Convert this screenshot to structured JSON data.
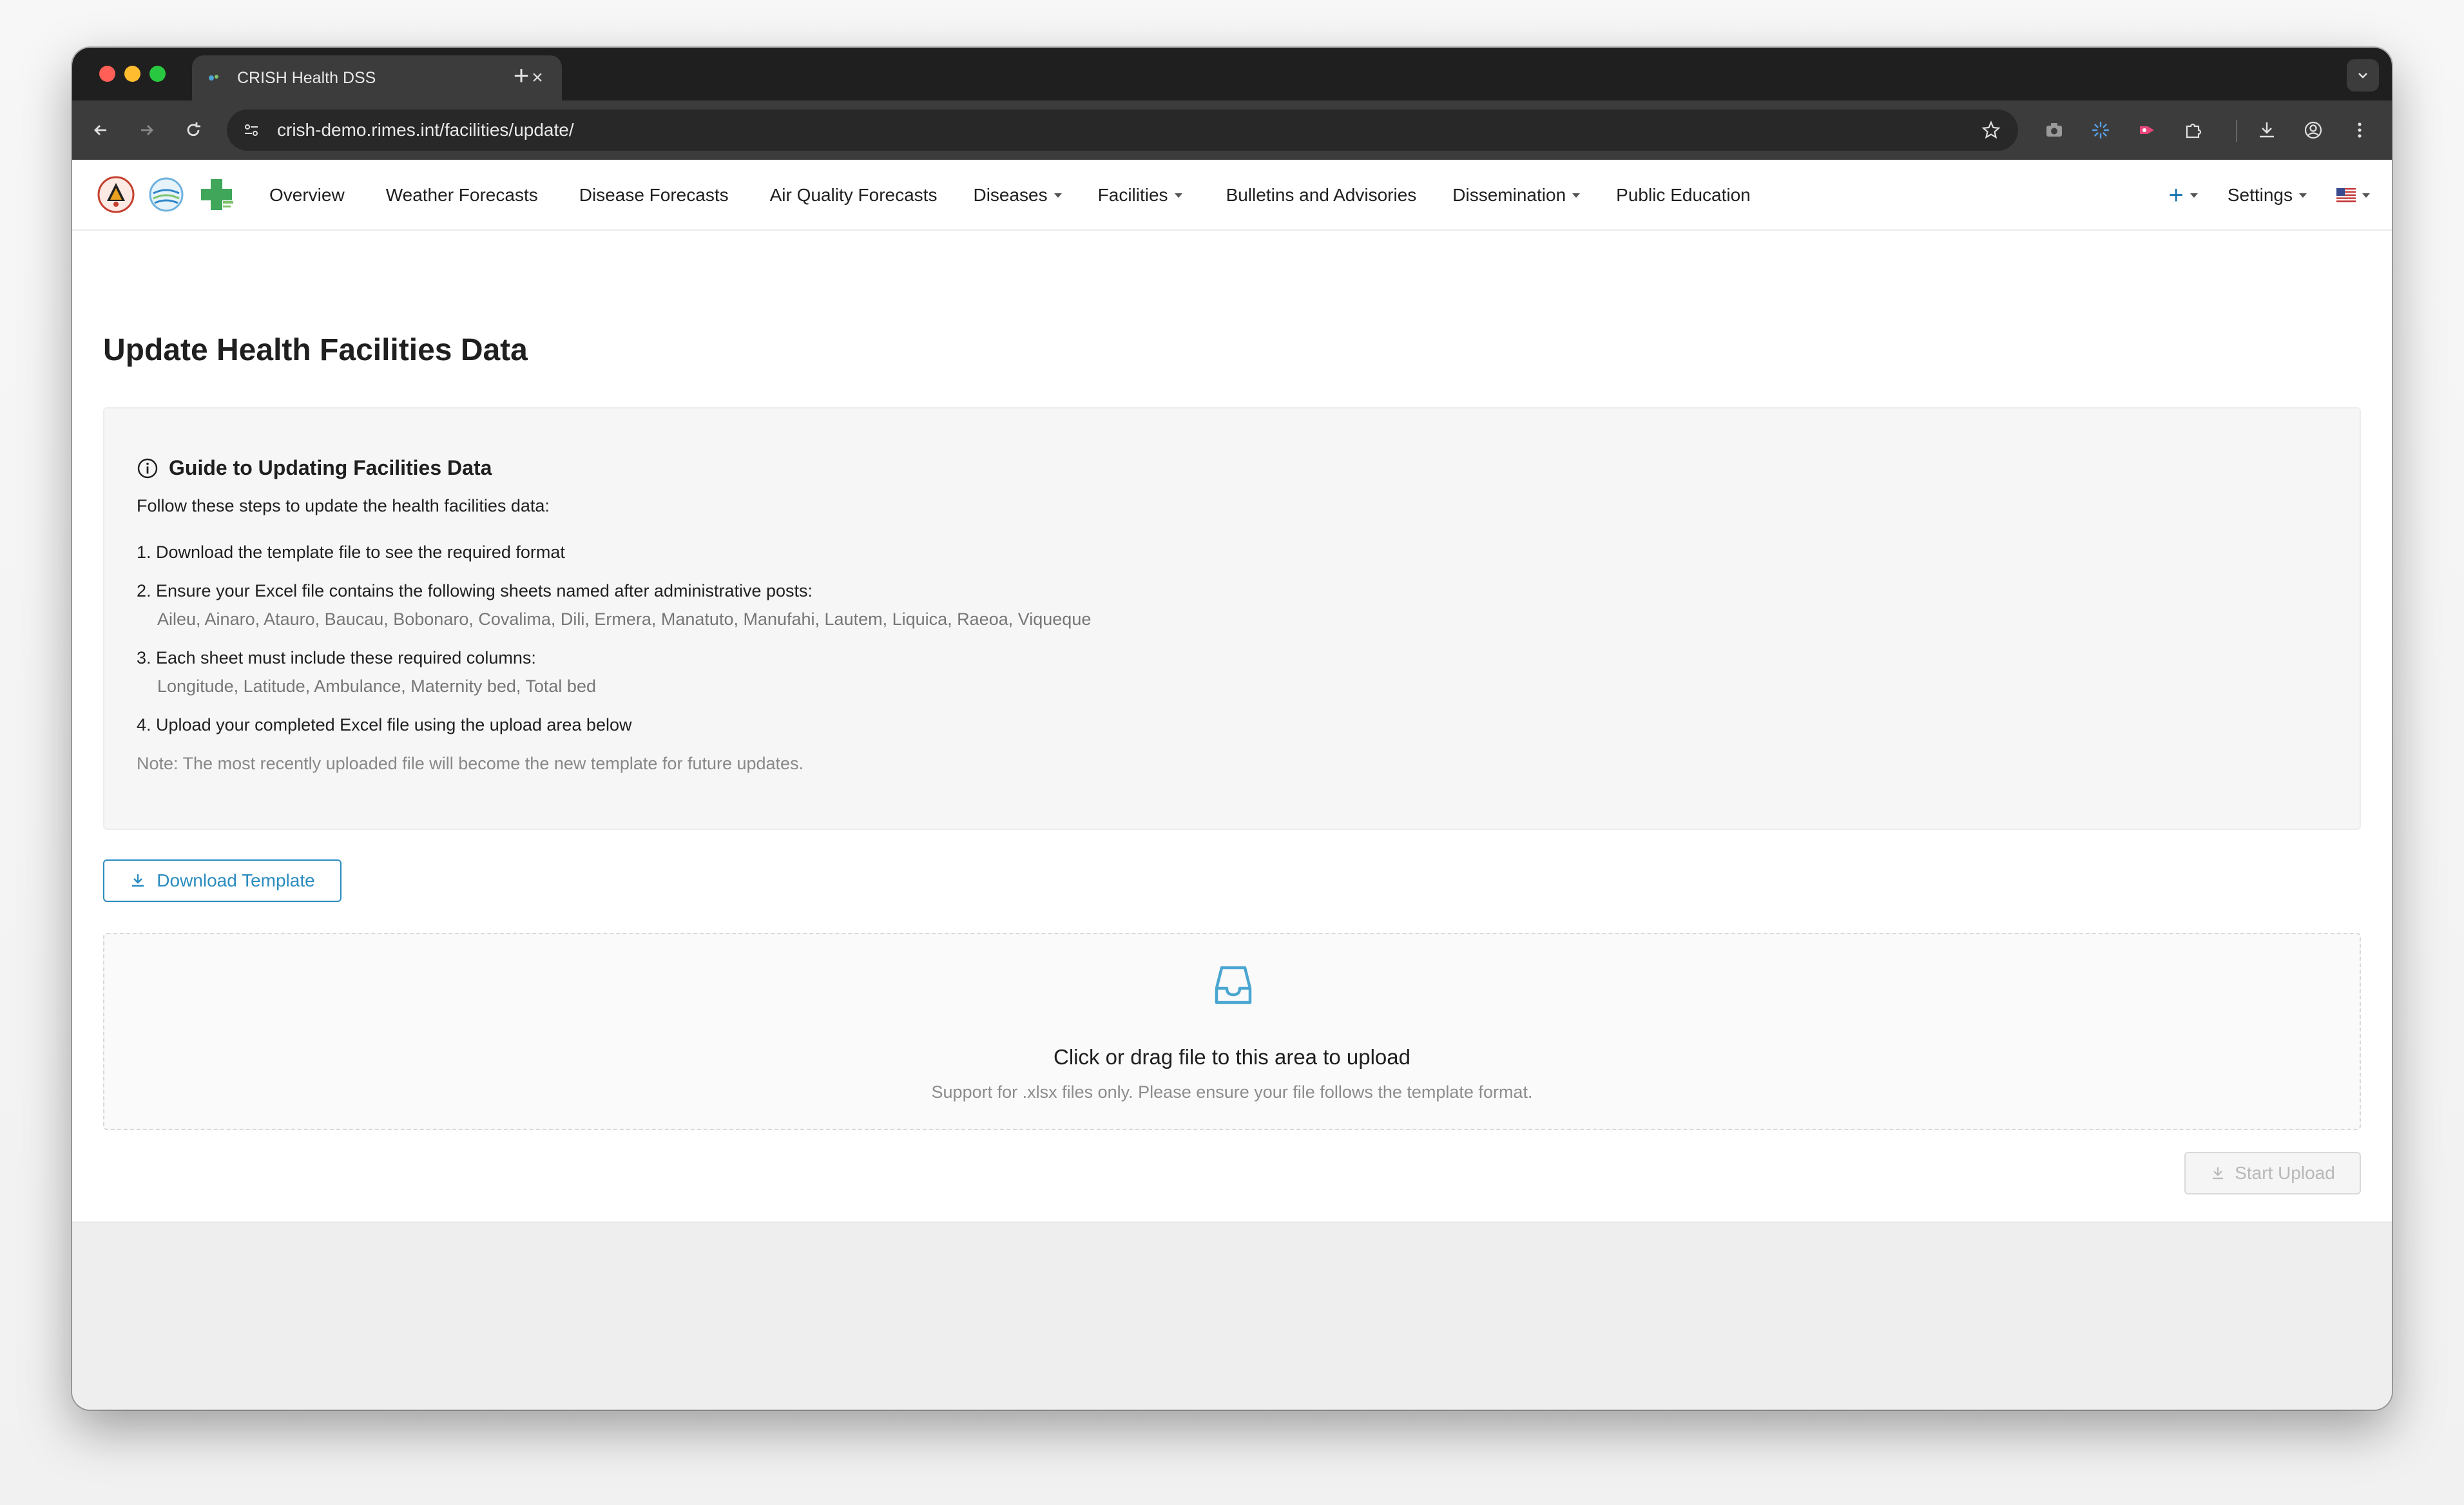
{
  "browser": {
    "tab_title": "CRISH Health DSS",
    "tab_close": "×",
    "new_tab": "+",
    "url": "crish-demo.rimes.int/facilities/update/"
  },
  "navbar": {
    "items": [
      {
        "label": "Overview",
        "dropdown": false
      },
      {
        "label": "Weather Forecasts",
        "dropdown": false
      },
      {
        "label": "Disease Forecasts",
        "dropdown": false
      },
      {
        "label": "Air Quality Forecasts",
        "dropdown": false
      },
      {
        "label": "Diseases",
        "dropdown": true
      },
      {
        "label": "Facilities",
        "dropdown": true
      },
      {
        "label": "Bulletins and Advisories",
        "dropdown": false
      },
      {
        "label": "Dissemination",
        "dropdown": true
      },
      {
        "label": "Public Education",
        "dropdown": false
      }
    ],
    "plus": "+",
    "settings": "Settings"
  },
  "page": {
    "title": "Update Health Facilities Data",
    "guide": {
      "heading": "Guide to Updating Facilities Data",
      "intro": "Follow these steps to update the health facilities data:",
      "step1": "1. Download the template file to see the required format",
      "step2": "2. Ensure your Excel file contains the following sheets named after administrative posts:",
      "step2_detail": "Aileu, Ainaro, Atauro, Baucau, Bobonaro, Covalima, Dili, Ermera, Manatuto, Manufahi, Lautem, Liquica, Raeoa, Viqueque",
      "step3": "3. Each sheet must include these required columns:",
      "step3_detail": "Longitude, Latitude, Ambulance, Maternity bed, Total bed",
      "step4": "4. Upload your completed Excel file using the upload area below",
      "note": "Note: The most recently uploaded file will become the new template for future updates."
    },
    "download_button": "Download Template",
    "upload": {
      "title": "Click or drag file to this area to upload",
      "hint": "Support for .xlsx files only. Please ensure your file follows the template format."
    },
    "start_button": "Start Upload"
  },
  "colors": {
    "accent": "#2a8bbf",
    "chrome_dark": "#1f1f1f",
    "chrome_toolbar": "#3c3c3c"
  },
  "icons": {
    "guide": "info-circle-icon",
    "download": "download-icon",
    "upload_area": "inbox-icon",
    "start_upload": "upload-icon"
  }
}
